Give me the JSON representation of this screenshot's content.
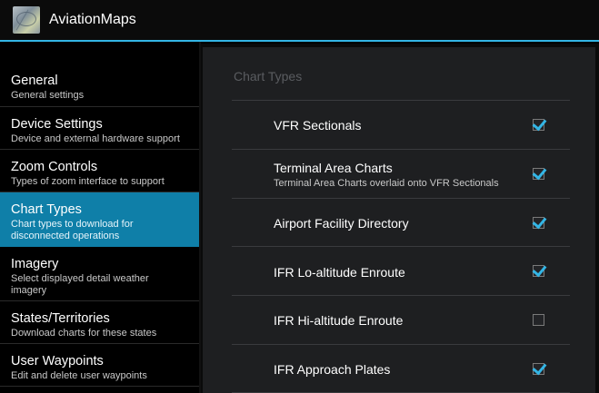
{
  "app": {
    "title": "AviationMaps"
  },
  "headers": [
    {
      "title": "General",
      "summary": "General settings"
    },
    {
      "title": "Device Settings",
      "summary": "Device and external hardware support"
    },
    {
      "title": "Zoom Controls",
      "summary": "Types of zoom interface to support"
    },
    {
      "title": "Chart Types",
      "summary": "Chart types to download for disconnected operations"
    },
    {
      "title": "Imagery",
      "summary": "Select displayed detail weather imagery"
    },
    {
      "title": "States/Territories",
      "summary": "Download charts for these states"
    },
    {
      "title": "User Waypoints",
      "summary": "Edit and delete user waypoints"
    }
  ],
  "selected_header": "Chart Types",
  "panel": {
    "category": "Chart Types",
    "prefs": [
      {
        "title": "VFR Sectionals",
        "summary": "",
        "checked": true
      },
      {
        "title": "Terminal Area Charts",
        "summary": "Terminal Area Charts overlaid onto VFR Sectionals",
        "checked": true
      },
      {
        "title": "Airport Facility Directory",
        "summary": "",
        "checked": true
      },
      {
        "title": "IFR Lo-altitude Enroute",
        "summary": "",
        "checked": true
      },
      {
        "title": "IFR Hi-altitude Enroute",
        "summary": "",
        "checked": false
      },
      {
        "title": "IFR Approach Plates",
        "summary": "",
        "checked": true
      }
    ]
  },
  "colors": {
    "accent": "#33b5e5",
    "selected_bg": "#0f7fa8"
  }
}
